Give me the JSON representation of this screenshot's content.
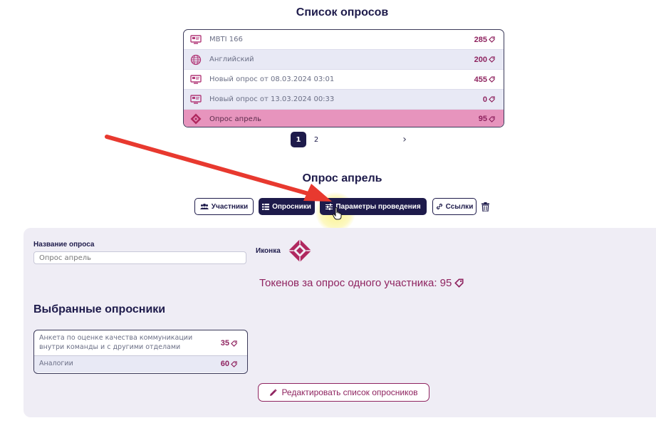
{
  "survey_list": {
    "title": "Список опросов",
    "rows": [
      {
        "label": "MBTI 166",
        "tokens": "285",
        "icon": "monitor-icon"
      },
      {
        "label": "Английский",
        "tokens": "200",
        "icon": "globe-icon"
      },
      {
        "label": "Новый опрос от 08.03.2024 03:01",
        "tokens": "455",
        "icon": "monitor-icon"
      },
      {
        "label": "Новый опрос от 13.03.2024 00:33",
        "tokens": "0",
        "icon": "monitor-icon"
      },
      {
        "label": "Опрос апрель",
        "tokens": "95",
        "icon": "diamond-logo-icon"
      }
    ],
    "selected_index": 4
  },
  "pagination": {
    "pages": [
      "1",
      "2"
    ],
    "current": "1",
    "next": "›"
  },
  "poll": {
    "title": "Опрос апрель",
    "tabs": {
      "participants": "Участники",
      "questionnaires": "Опросники",
      "params": "Параметры проведения",
      "links": "Ссылки"
    }
  },
  "settings": {
    "name_label": "Название опроса",
    "name_placeholder": "Опрос апрель",
    "icon_label": "Иконка",
    "tokens_text": "Токенов за опрос одного участника: 95",
    "selected_title": "Выбранные опросники",
    "questionnaires": [
      {
        "label": "Анкета по оценке качества коммуникации внутри команды и с другими отделами",
        "tokens": "35"
      },
      {
        "label": "Аналогии",
        "tokens": "60"
      }
    ],
    "edit_button": "Редактировать список опросников"
  },
  "colors": {
    "navy": "#1e1b4b",
    "accent": "#8f2460",
    "selected_row": "#e794bd",
    "arrow": "#e8392f"
  }
}
